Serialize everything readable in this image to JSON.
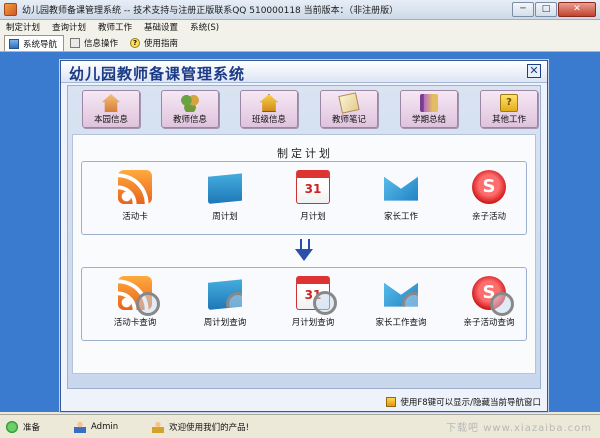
{
  "window": {
    "title": "幼儿园教师备课管理系统 -- 技术支持与注册正版联系QQ 510000118    当前版本：（非注册版）",
    "min_label": "─",
    "max_label": "□",
    "close_label": "✕"
  },
  "menu": {
    "items": [
      "制定计划",
      "查询计划",
      "教师工作",
      "基础设置",
      "系统(S)"
    ]
  },
  "toolbar": {
    "tabs": [
      {
        "label": "系统导航",
        "icon": "nav-icon",
        "active": true
      },
      {
        "label": "信息操作",
        "icon": "info-icon",
        "active": false
      },
      {
        "label": "使用指南",
        "icon": "help-icon",
        "active": false
      }
    ]
  },
  "panel": {
    "title": "幼儿园教师备课管理系统",
    "close_label": "✕",
    "categories": [
      {
        "label": "本园信息",
        "icon": "house-icon"
      },
      {
        "label": "教师信息",
        "icon": "people-icon"
      },
      {
        "label": "班级信息",
        "icon": "class-icon"
      },
      {
        "label": "教师笔记",
        "icon": "note-icon"
      },
      {
        "label": "学期总结",
        "icon": "book-icon"
      },
      {
        "label": "其他工作",
        "icon": "other-icon",
        "glyph": "?"
      }
    ],
    "section_title": "制定计划",
    "plan_items": [
      {
        "label": "活动卡",
        "icon": "rss-icon"
      },
      {
        "label": "周计划",
        "icon": "week-plan-icon"
      },
      {
        "label": "月计划",
        "icon": "month-plan-icon",
        "glyph": "31"
      },
      {
        "label": "家长工作",
        "icon": "parent-work-icon"
      },
      {
        "label": "亲子活动",
        "icon": "family-activity-icon",
        "glyph": "S"
      }
    ],
    "query_items": [
      {
        "label": "活动卡查询",
        "icon": "rss-search-icon"
      },
      {
        "label": "周计划查询",
        "icon": "week-plan-search-icon"
      },
      {
        "label": "月计划查询",
        "icon": "month-plan-search-icon",
        "glyph": "31"
      },
      {
        "label": "家长工作查询",
        "icon": "parent-work-search-icon"
      },
      {
        "label": "亲子活动查询",
        "icon": "family-activity-search-icon",
        "glyph": "S"
      }
    ],
    "hint": "使用F8键可以显示/隐藏当前导航窗口"
  },
  "status": {
    "ready": "准备",
    "user": "Admin",
    "welcome": "欢迎使用我们的产品!",
    "watermark": "下载吧 www.xiazaiba.com"
  }
}
